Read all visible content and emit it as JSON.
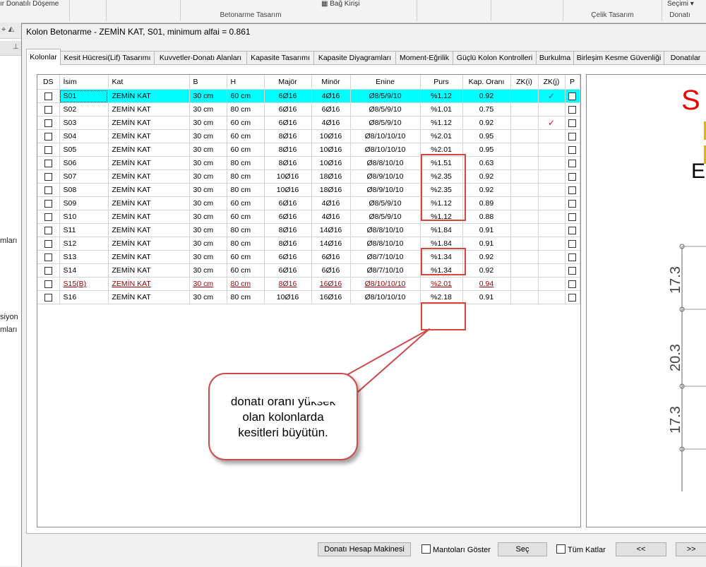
{
  "ribbon": {
    "items": [
      "ır Donatılı Döşeme",
      "Bağ Kirişi",
      "Seçimi"
    ],
    "groups": [
      "Betonarme Tasarım",
      "Çelik Tasarım",
      "Donatı"
    ]
  },
  "left_labels": [
    "mları",
    "siyon",
    "mları"
  ],
  "dialog": {
    "title": "Kolon Betonarme - ZEMİN KAT, S01, minimum alfai = 0.861"
  },
  "tabs": [
    "Kolonlar",
    "Kesit Hücresi(Lif) Tasarımı",
    "Kuvvetler-Donatı Alanları",
    "Kapasite Tasarımı",
    "Kapasite Diyagramları",
    "Moment-Eğrilik",
    "Güçlü Kolon Kontrolleri",
    "Burkulma",
    "Birleşim Kesme Güvenliği",
    "Donatılar"
  ],
  "table": {
    "headers": [
      "DS",
      "İsim",
      "Kat",
      "B",
      "H",
      "Majör",
      "Minör",
      "Enine",
      "Purs",
      "Kap. Oranı",
      "ZK(i)",
      "ZK(j)",
      "P"
    ],
    "rows": [
      [
        "S01",
        "ZEMİN KAT",
        "30 cm",
        "60 cm",
        "6Ø16",
        "4Ø16",
        "Ø8/5/9/10",
        "%1.12",
        "0.92"
      ],
      [
        "S02",
        "ZEMİN KAT",
        "30 cm",
        "80 cm",
        "6Ø16",
        "6Ø16",
        "Ø8/5/9/10",
        "%1.01",
        "0.75"
      ],
      [
        "S03",
        "ZEMİN KAT",
        "30 cm",
        "60 cm",
        "6Ø16",
        "4Ø16",
        "Ø8/5/9/10",
        "%1.12",
        "0.92"
      ],
      [
        "S04",
        "ZEMİN KAT",
        "30 cm",
        "60 cm",
        "8Ø16",
        "10Ø16",
        "Ø8/10/10/10",
        "%2.01",
        "0.95"
      ],
      [
        "S05",
        "ZEMİN KAT",
        "30 cm",
        "60 cm",
        "8Ø16",
        "10Ø16",
        "Ø8/10/10/10",
        "%2.01",
        "0.95"
      ],
      [
        "S06",
        "ZEMİN KAT",
        "30 cm",
        "80 cm",
        "8Ø16",
        "10Ø16",
        "Ø8/8/10/10",
        "%1.51",
        "0.63"
      ],
      [
        "S07",
        "ZEMİN KAT",
        "30 cm",
        "80 cm",
        "10Ø16",
        "18Ø16",
        "Ø8/9/10/10",
        "%2.35",
        "0.92"
      ],
      [
        "S08",
        "ZEMİN KAT",
        "30 cm",
        "80 cm",
        "10Ø16",
        "18Ø16",
        "Ø8/9/10/10",
        "%2.35",
        "0.92"
      ],
      [
        "S09",
        "ZEMİN KAT",
        "30 cm",
        "60 cm",
        "6Ø16",
        "4Ø16",
        "Ø8/5/9/10",
        "%1.12",
        "0.89"
      ],
      [
        "S10",
        "ZEMİN KAT",
        "30 cm",
        "60 cm",
        "6Ø16",
        "4Ø16",
        "Ø8/5/9/10",
        "%1.12",
        "0.88"
      ],
      [
        "S11",
        "ZEMİN KAT",
        "30 cm",
        "80 cm",
        "8Ø16",
        "14Ø16",
        "Ø8/8/10/10",
        "%1.84",
        "0.91"
      ],
      [
        "S12",
        "ZEMİN KAT",
        "30 cm",
        "80 cm",
        "8Ø16",
        "14Ø16",
        "Ø8/8/10/10",
        "%1.84",
        "0.91"
      ],
      [
        "S13",
        "ZEMİN KAT",
        "30 cm",
        "60 cm",
        "6Ø16",
        "6Ø16",
        "Ø8/7/10/10",
        "%1.34",
        "0.92"
      ],
      [
        "S14",
        "ZEMİN KAT",
        "30 cm",
        "60 cm",
        "6Ø16",
        "6Ø16",
        "Ø8/7/10/10",
        "%1.34",
        "0.92"
      ],
      [
        "S15(B)",
        "ZEMİN KAT",
        "30 cm",
        "80 cm",
        "8Ø16",
        "16Ø16",
        "Ø8/10/10/10",
        "%2.01",
        "0.94"
      ],
      [
        "S16",
        "ZEMİN KAT",
        "30 cm",
        "80 cm",
        "10Ø16",
        "16Ø16",
        "Ø8/10/10/10",
        "%2.18",
        "0.91"
      ]
    ],
    "zkj_ticks": {
      "S01": "✓",
      "S03": "✓"
    }
  },
  "callout": {
    "lines": [
      "donatı oranı yüksek",
      "olan kolonlarda",
      "kesitleri büyütün."
    ]
  },
  "preview": {
    "label_red": "S",
    "label_black": "E",
    "dims": [
      "17.3",
      "20.3",
      "17.3"
    ]
  },
  "bottom": {
    "calc_button": "Donatı Hesap Makinesi",
    "mantolar_label": "Mantoları Göster",
    "sec_button": "Seç",
    "tum_katlar_label": "Tüm Katlar",
    "prev_button": "<<",
    "next_button": ">>"
  },
  "colors": {
    "selection": "#00ffff",
    "highlight_box": "#d9463c",
    "error_row": "#9c0006",
    "preview_title": "#ee0000"
  }
}
